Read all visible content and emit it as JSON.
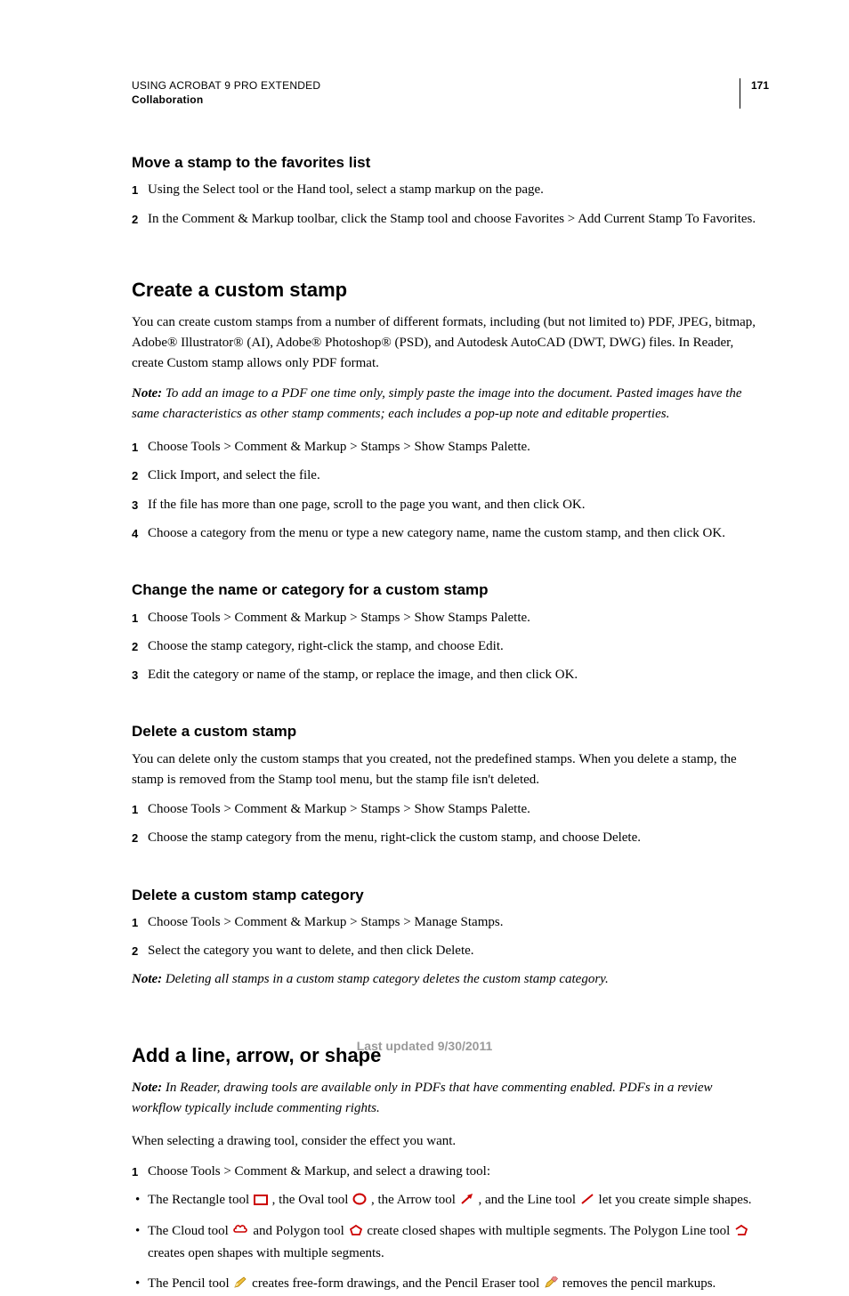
{
  "header": {
    "product": "USING ACROBAT 9 PRO EXTENDED",
    "chapter": "Collaboration",
    "page": "171"
  },
  "sec_move_favorites": {
    "title": "Move a stamp to the favorites list",
    "steps": [
      "Using the Select tool or the Hand tool, select a stamp markup on the page.",
      "In the Comment & Markup toolbar, click the Stamp tool and choose Favorites > Add Current Stamp To Favorites."
    ]
  },
  "sec_create_custom": {
    "title": "Create a custom stamp",
    "intro": "You can create custom stamps from a number of different formats, including (but not limited to) PDF, JPEG, bitmap, Adobe® Illustrator® (AI), Adobe® Photoshop® (PSD), and Autodesk AutoCAD (DWT, DWG) files. In Reader, create Custom stamp allows only PDF format.",
    "note_label": "Note:",
    "note_body": " To add an image to a PDF one time only, simply paste the image into the document. Pasted images have the same characteristics as other stamp comments; each includes a pop-up note and editable properties.",
    "steps": [
      "Choose Tools > Comment & Markup > Stamps > Show Stamps Palette.",
      "Click Import, and select the file.",
      "If the file has more than one page, scroll to the page you want, and then click OK.",
      "Choose a category from the menu or type a new category name, name the custom stamp, and then click OK."
    ]
  },
  "sec_change_name": {
    "title": "Change the name or category for a custom stamp",
    "steps": [
      "Choose Tools > Comment & Markup > Stamps > Show Stamps Palette.",
      "Choose the stamp category, right-click the stamp, and choose Edit.",
      "Edit the category or name of the stamp, or replace the image, and then click OK."
    ]
  },
  "sec_delete_stamp": {
    "title": "Delete a custom stamp",
    "intro": "You can delete only the custom stamps that you created, not the predefined stamps. When you delete a stamp, the stamp is removed from the Stamp tool menu, but the stamp file isn't deleted.",
    "steps": [
      "Choose Tools > Comment & Markup > Stamps > Show Stamps Palette.",
      "Choose the stamp category from the menu, right-click the custom stamp, and choose Delete."
    ]
  },
  "sec_delete_category": {
    "title": "Delete a custom stamp category",
    "steps": [
      "Choose Tools > Comment & Markup > Stamps > Manage Stamps.",
      "Select the category you want to delete, and then click Delete."
    ],
    "note_label": "Note:",
    "note_body": " Deleting all stamps in a custom stamp category deletes the custom stamp category."
  },
  "sec_add_line": {
    "title": "Add a line, arrow, or shape",
    "note_label": "Note:",
    "note_body": " In Reader, drawing tools are available only in PDFs that have commenting enabled. PDFs in a review workflow typically include commenting rights.",
    "intro": "When selecting a drawing tool, consider the effect you want.",
    "step1": "Choose Tools > Comment & Markup, and select a drawing tool:",
    "bullet1_a": "The Rectangle tool ",
    "bullet1_b": ", the Oval tool ",
    "bullet1_c": ", the Arrow tool ",
    "bullet1_d": ", and the Line tool ",
    "bullet1_e": " let you create simple shapes.",
    "bullet2_a": "The Cloud tool ",
    "bullet2_b": " and Polygon tool ",
    "bullet2_c": " create closed shapes with multiple segments. The Polygon Line tool ",
    "bullet2_d": " creates open shapes with multiple segments.",
    "bullet3_a": "The Pencil tool ",
    "bullet3_b": " creates free-form drawings, and the Pencil Eraser tool ",
    "bullet3_c": " removes the pencil markups."
  },
  "footer": "Last updated 9/30/2011"
}
